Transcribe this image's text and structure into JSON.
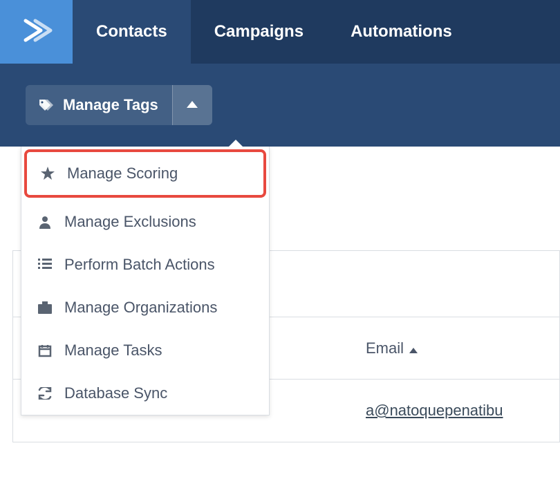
{
  "nav": {
    "tabs": [
      "Contacts",
      "Campaigns",
      "Automations"
    ],
    "active_index": 0
  },
  "sub": {
    "manage_tags_label": "Manage Tags"
  },
  "dropdown": {
    "items": [
      {
        "icon": "star",
        "label": "Manage Scoring",
        "highlight": true
      },
      {
        "icon": "person",
        "label": "Manage Exclusions"
      },
      {
        "icon": "list",
        "label": "Perform Batch Actions"
      },
      {
        "icon": "briefcase",
        "label": "Manage Organizations"
      },
      {
        "icon": "calendar",
        "label": "Manage Tasks"
      },
      {
        "icon": "sync",
        "label": "Database Sync"
      }
    ]
  },
  "table": {
    "columns": {
      "email": "Email"
    },
    "rows": [
      {
        "email": "a@natoquepenatibu"
      }
    ]
  }
}
